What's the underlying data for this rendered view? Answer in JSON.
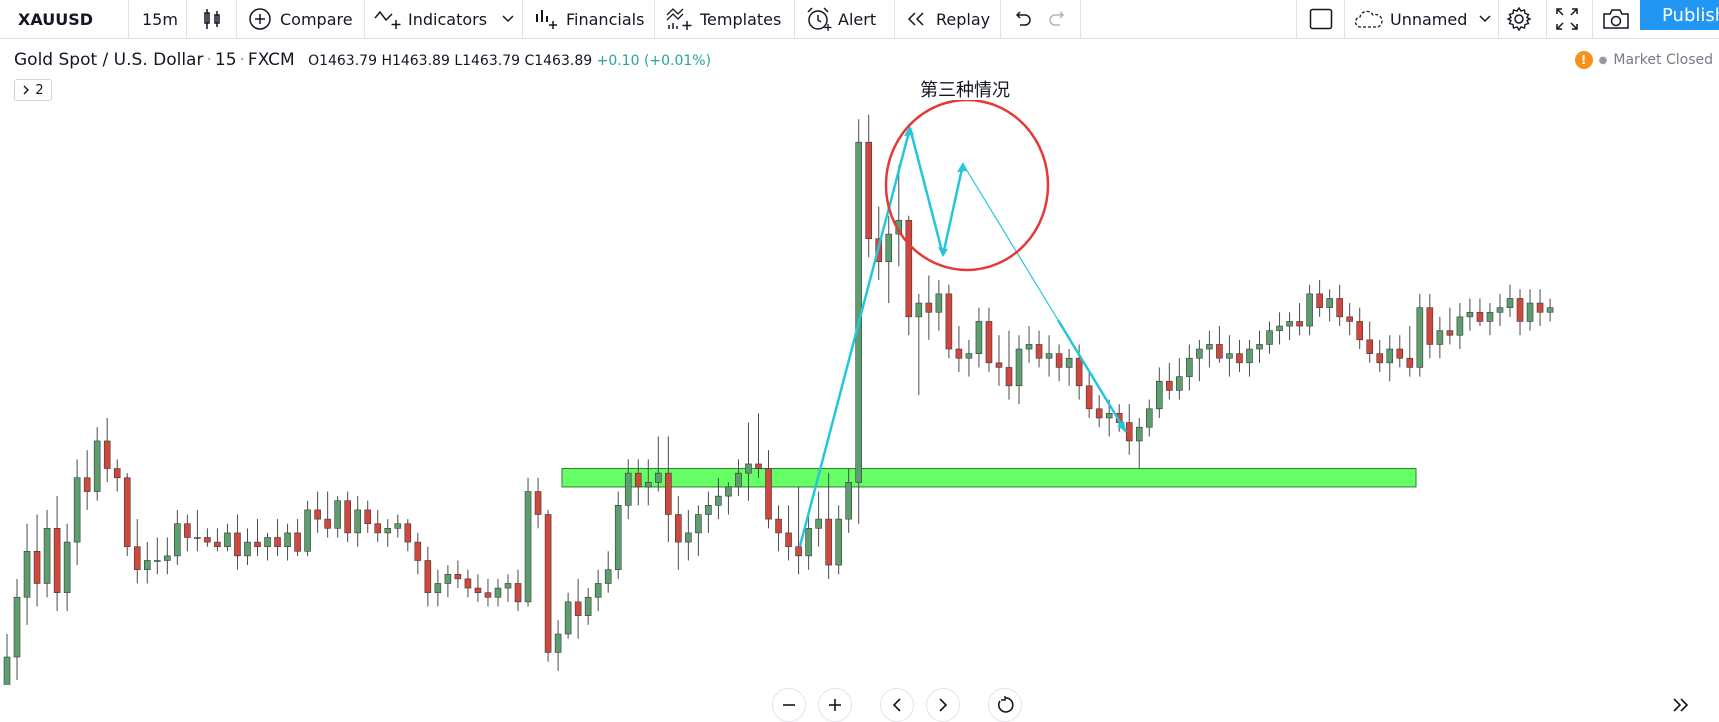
{
  "toolbar": {
    "symbol": "XAUUSD",
    "interval": "15m",
    "compare_label": "Compare",
    "indicators_label": "Indicators",
    "financials_label": "Financials",
    "templates_label": "Templates",
    "alert_label": "Alert",
    "replay_label": "Replay",
    "layout_name": "Unnamed",
    "publish_label": "Publish"
  },
  "legend": {
    "title": "Gold Spot / U.S. Dollar",
    "interval": "15",
    "source": "FXCM",
    "open": "O1463.79",
    "high": "H1463.89",
    "low": "L1463.79",
    "close": "C1463.89",
    "change": "+0.10 (+0.01%)",
    "collapse_count": "2"
  },
  "status": {
    "market": "Market Closed"
  },
  "annotation": {
    "text": "第三种情况"
  },
  "colors": {
    "up": "#5c9e6e",
    "down": "#d0473e",
    "zone": "#66ff66",
    "trend_line": "#26c6da",
    "circle": "#e53935",
    "publish": "#2196f3"
  },
  "chart_data": {
    "type": "candlestick",
    "symbol": "XAUUSD",
    "interval": "15",
    "ohlc": [
      [
        1456.2,
        1457.8,
        1455.6,
        1457.3
      ],
      [
        1457.3,
        1459.0,
        1456.8,
        1458.6
      ],
      [
        1458.6,
        1460.2,
        1458.0,
        1459.6
      ],
      [
        1459.6,
        1460.4,
        1458.4,
        1458.9
      ],
      [
        1458.9,
        1460.5,
        1458.6,
        1460.1
      ],
      [
        1460.1,
        1460.8,
        1458.3,
        1458.7
      ],
      [
        1458.7,
        1460.2,
        1458.3,
        1459.8
      ],
      [
        1459.8,
        1461.6,
        1459.3,
        1461.2
      ],
      [
        1461.2,
        1461.8,
        1460.5,
        1460.9
      ],
      [
        1460.9,
        1462.3,
        1460.7,
        1462.0
      ],
      [
        1462.0,
        1462.5,
        1461.1,
        1461.4
      ],
      [
        1461.4,
        1461.6,
        1460.9,
        1461.2
      ],
      [
        1461.2,
        1461.3,
        1459.5,
        1459.7
      ],
      [
        1459.7,
        1460.3,
        1458.9,
        1459.2
      ],
      [
        1459.2,
        1459.8,
        1458.9,
        1459.4
      ],
      [
        1459.4,
        1459.9,
        1459.1,
        1459.4
      ],
      [
        1459.4,
        1459.9,
        1459.1,
        1459.5
      ],
      [
        1459.5,
        1460.5,
        1459.3,
        1460.2
      ],
      [
        1460.2,
        1460.4,
        1459.6,
        1459.9
      ],
      [
        1459.9,
        1460.5,
        1459.6,
        1459.9
      ],
      [
        1459.9,
        1460.1,
        1459.7,
        1459.8
      ],
      [
        1459.8,
        1460.1,
        1459.6,
        1459.7
      ],
      [
        1459.7,
        1460.2,
        1459.6,
        1460.0
      ],
      [
        1460.0,
        1460.4,
        1459.2,
        1459.5
      ],
      [
        1459.5,
        1460.1,
        1459.3,
        1459.8
      ],
      [
        1459.8,
        1460.3,
        1459.5,
        1459.7
      ],
      [
        1459.7,
        1460.0,
        1459.4,
        1459.9
      ],
      [
        1459.9,
        1460.3,
        1459.5,
        1459.7
      ],
      [
        1459.7,
        1460.2,
        1459.4,
        1460.0
      ],
      [
        1460.0,
        1460.3,
        1459.5,
        1459.6
      ],
      [
        1459.6,
        1460.7,
        1459.5,
        1460.5
      ],
      [
        1460.5,
        1460.9,
        1460.0,
        1460.3
      ],
      [
        1460.3,
        1460.9,
        1459.9,
        1460.1
      ],
      [
        1460.1,
        1460.8,
        1459.9,
        1460.7
      ],
      [
        1460.7,
        1460.9,
        1459.8,
        1460.0
      ],
      [
        1460.0,
        1460.8,
        1459.7,
        1460.5
      ],
      [
        1460.5,
        1460.7,
        1460.0,
        1460.2
      ],
      [
        1460.2,
        1460.5,
        1459.8,
        1460.0
      ],
      [
        1460.0,
        1460.3,
        1459.7,
        1460.1
      ],
      [
        1460.1,
        1460.4,
        1459.9,
        1460.2
      ],
      [
        1460.2,
        1460.3,
        1459.6,
        1459.8
      ],
      [
        1459.8,
        1460.0,
        1459.1,
        1459.4
      ],
      [
        1459.4,
        1459.7,
        1458.4,
        1458.7
      ],
      [
        1458.7,
        1459.2,
        1458.4,
        1458.9
      ],
      [
        1458.9,
        1459.3,
        1458.6,
        1459.1
      ],
      [
        1459.1,
        1459.4,
        1458.8,
        1459.0
      ],
      [
        1459.0,
        1459.2,
        1458.6,
        1458.8
      ],
      [
        1458.8,
        1459.1,
        1458.5,
        1458.7
      ],
      [
        1458.7,
        1459.0,
        1458.4,
        1458.6
      ],
      [
        1458.6,
        1459.0,
        1458.4,
        1458.8
      ],
      [
        1458.8,
        1459.1,
        1458.5,
        1458.9
      ],
      [
        1458.9,
        1459.2,
        1458.3,
        1458.5
      ],
      [
        1458.5,
        1461.2,
        1458.4,
        1460.9
      ],
      [
        1460.9,
        1461.2,
        1460.1,
        1460.4
      ],
      [
        1460.4,
        1460.5,
        1457.2,
        1457.4
      ],
      [
        1457.4,
        1458.1,
        1457.0,
        1457.8
      ],
      [
        1457.8,
        1458.7,
        1457.7,
        1458.5
      ],
      [
        1458.5,
        1459.0,
        1457.7,
        1458.2
      ],
      [
        1458.2,
        1458.8,
        1458.0,
        1458.6
      ],
      [
        1458.6,
        1459.2,
        1458.3,
        1458.9
      ],
      [
        1458.9,
        1459.6,
        1458.7,
        1459.2
      ],
      [
        1459.2,
        1460.9,
        1459.0,
        1460.6
      ],
      [
        1460.6,
        1461.6,
        1460.3,
        1461.3
      ],
      [
        1461.3,
        1461.6,
        1460.6,
        1461.0
      ],
      [
        1461.0,
        1461.6,
        1460.6,
        1461.1
      ],
      [
        1461.1,
        1462.1,
        1460.9,
        1461.3
      ],
      [
        1461.3,
        1462.1,
        1459.8,
        1460.4
      ],
      [
        1460.4,
        1460.8,
        1459.2,
        1459.8
      ],
      [
        1459.8,
        1460.5,
        1459.4,
        1460.0
      ],
      [
        1460.0,
        1460.6,
        1459.5,
        1460.4
      ],
      [
        1460.4,
        1460.9,
        1460.0,
        1460.6
      ],
      [
        1460.6,
        1461.2,
        1460.3,
        1460.8
      ],
      [
        1460.8,
        1461.1,
        1460.4,
        1461.0
      ],
      [
        1461.0,
        1461.6,
        1460.8,
        1461.3
      ],
      [
        1461.3,
        1462.4,
        1460.7,
        1461.5
      ],
      [
        1461.5,
        1462.6,
        1461.2,
        1461.4
      ],
      [
        1461.4,
        1461.8,
        1460.1,
        1460.3
      ],
      [
        1460.3,
        1460.6,
        1459.6,
        1460.0
      ],
      [
        1460.0,
        1460.6,
        1459.4,
        1459.7
      ],
      [
        1459.7,
        1461.0,
        1459.1,
        1459.5
      ],
      [
        1459.5,
        1460.4,
        1459.2,
        1460.1
      ],
      [
        1460.1,
        1460.9,
        1459.7,
        1460.3
      ],
      [
        1460.3,
        1461.3,
        1459.0,
        1459.3
      ],
      [
        1459.3,
        1460.6,
        1459.1,
        1460.3
      ],
      [
        1460.3,
        1461.4,
        1460.0,
        1461.1
      ],
      [
        1461.1,
        1469.0,
        1460.2,
        1468.5
      ],
      [
        1468.5,
        1469.1,
        1466.0,
        1466.4
      ],
      [
        1466.4,
        1467.1,
        1465.5,
        1465.9
      ],
      [
        1465.9,
        1466.9,
        1465.0,
        1466.5
      ],
      [
        1466.5,
        1468.0,
        1465.8,
        1466.8
      ],
      [
        1466.8,
        1466.9,
        1464.3,
        1464.7
      ],
      [
        1464.7,
        1465.2,
        1463.0,
        1465.0
      ],
      [
        1465.0,
        1465.6,
        1464.2,
        1464.8
      ],
      [
        1464.8,
        1465.5,
        1464.4,
        1465.2
      ],
      [
        1465.2,
        1465.4,
        1463.8,
        1464.0
      ],
      [
        1464.0,
        1464.5,
        1463.5,
        1463.8
      ],
      [
        1463.8,
        1464.2,
        1463.4,
        1463.9
      ],
      [
        1463.9,
        1464.9,
        1463.6,
        1464.6
      ],
      [
        1464.6,
        1464.9,
        1463.5,
        1463.7
      ],
      [
        1463.7,
        1464.3,
        1463.2,
        1463.6
      ],
      [
        1463.6,
        1464.4,
        1462.9,
        1463.2
      ],
      [
        1463.2,
        1464.3,
        1462.8,
        1464.0
      ],
      [
        1464.0,
        1464.5,
        1463.7,
        1464.1
      ],
      [
        1464.1,
        1464.4,
        1463.6,
        1463.8
      ],
      [
        1463.8,
        1464.3,
        1463.4,
        1463.9
      ],
      [
        1463.9,
        1464.1,
        1463.3,
        1463.6
      ],
      [
        1463.6,
        1464.0,
        1463.2,
        1463.8
      ],
      [
        1463.8,
        1464.1,
        1462.9,
        1463.2
      ],
      [
        1463.2,
        1463.5,
        1462.5,
        1462.7
      ],
      [
        1462.7,
        1463.0,
        1462.3,
        1462.5
      ],
      [
        1462.5,
        1462.9,
        1462.1,
        1462.6
      ],
      [
        1462.6,
        1462.8,
        1462.2,
        1462.4
      ],
      [
        1462.4,
        1462.8,
        1461.7,
        1462.0
      ],
      [
        1462.0,
        1462.5,
        1461.4,
        1462.3
      ],
      [
        1462.3,
        1462.9,
        1462.1,
        1462.7
      ],
      [
        1462.7,
        1463.6,
        1462.5,
        1463.3
      ],
      [
        1463.3,
        1463.7,
        1462.9,
        1463.1
      ],
      [
        1463.1,
        1463.8,
        1462.9,
        1463.4
      ],
      [
        1463.4,
        1464.1,
        1463.1,
        1463.8
      ],
      [
        1463.8,
        1464.2,
        1463.3,
        1464.0
      ],
      [
        1464.0,
        1464.4,
        1463.6,
        1464.1
      ],
      [
        1464.1,
        1464.5,
        1463.7,
        1463.8
      ],
      [
        1463.8,
        1464.3,
        1463.4,
        1463.9
      ],
      [
        1463.9,
        1464.2,
        1463.5,
        1463.7
      ],
      [
        1463.7,
        1464.2,
        1463.4,
        1464.0
      ],
      [
        1464.0,
        1464.4,
        1463.7,
        1464.1
      ],
      [
        1464.1,
        1464.6,
        1463.9,
        1464.4
      ],
      [
        1464.4,
        1464.8,
        1464.1,
        1464.5
      ],
      [
        1464.5,
        1464.8,
        1464.2,
        1464.6
      ],
      [
        1464.6,
        1465.0,
        1464.3,
        1464.5
      ],
      [
        1464.5,
        1465.4,
        1464.3,
        1465.2
      ],
      [
        1465.2,
        1465.5,
        1464.7,
        1464.9
      ],
      [
        1464.9,
        1465.3,
        1464.6,
        1465.1
      ],
      [
        1465.1,
        1465.4,
        1464.5,
        1464.7
      ],
      [
        1464.7,
        1465.0,
        1464.3,
        1464.6
      ],
      [
        1464.6,
        1464.9,
        1464.0,
        1464.2
      ],
      [
        1464.2,
        1464.6,
        1463.7,
        1463.9
      ],
      [
        1463.9,
        1464.2,
        1463.5,
        1463.7
      ],
      [
        1463.7,
        1464.3,
        1463.3,
        1464.0
      ],
      [
        1464.0,
        1464.3,
        1463.6,
        1463.8
      ],
      [
        1463.8,
        1464.5,
        1463.4,
        1463.6
      ],
      [
        1463.6,
        1465.2,
        1463.4,
        1464.9
      ],
      [
        1464.9,
        1465.2,
        1463.8,
        1464.1
      ],
      [
        1464.1,
        1464.7,
        1463.8,
        1464.4
      ],
      [
        1464.4,
        1464.9,
        1464.1,
        1464.3
      ],
      [
        1464.3,
        1465.0,
        1464.0,
        1464.7
      ],
      [
        1464.7,
        1465.1,
        1464.4,
        1464.8
      ],
      [
        1464.8,
        1465.1,
        1464.5,
        1464.6
      ],
      [
        1464.6,
        1465.0,
        1464.3,
        1464.8
      ],
      [
        1464.8,
        1465.2,
        1464.5,
        1464.9
      ],
      [
        1464.9,
        1465.4,
        1464.7,
        1465.1
      ],
      [
        1465.1,
        1465.3,
        1464.3,
        1464.6
      ],
      [
        1464.6,
        1465.3,
        1464.4,
        1465.0
      ],
      [
        1465.0,
        1465.3,
        1464.5,
        1464.8
      ],
      [
        1464.8,
        1465.1,
        1464.6,
        1464.9
      ]
    ],
    "support_zone": {
      "low": 1461.0,
      "high": 1461.4
    },
    "drawings": [
      "rectangle-zone",
      "trend-lines",
      "ellipse"
    ]
  }
}
